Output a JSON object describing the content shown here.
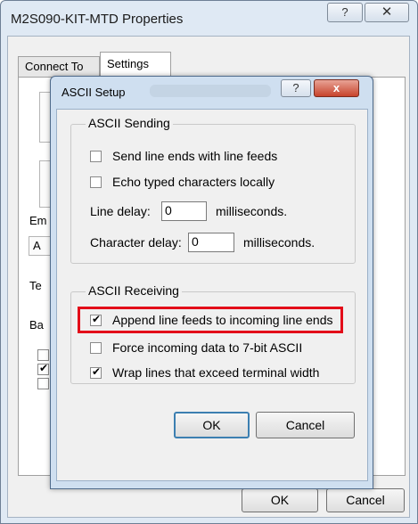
{
  "outer": {
    "title": "M2S090-KIT-MTD Properties",
    "help_glyph": "?",
    "close_glyph": "✕",
    "tabs": [
      "Connect To",
      "Settings"
    ],
    "ok_label": "OK",
    "cancel_label": "Cancel",
    "partial_labels": [
      "Em",
      "A",
      "Te",
      "Ba"
    ]
  },
  "dialog": {
    "title": "ASCII Setup",
    "help_glyph": "?",
    "close_glyph": "x",
    "sending": {
      "legend": "ASCII Sending",
      "options": [
        {
          "label": "Send line ends with line feeds",
          "checked": false
        },
        {
          "label": "Echo typed characters locally",
          "checked": false
        }
      ],
      "line_delay_label": "Line delay:",
      "line_delay_value": "0",
      "line_delay_unit": "milliseconds.",
      "char_delay_label": "Character delay:",
      "char_delay_value": "0",
      "char_delay_unit": "milliseconds."
    },
    "receiving": {
      "legend": "ASCII Receiving",
      "options": [
        {
          "label": "Append line feeds to incoming line ends",
          "checked": true
        },
        {
          "label": "Force incoming data to 7-bit ASCII",
          "checked": false
        },
        {
          "label": "Wrap lines that exceed terminal width",
          "checked": true
        }
      ]
    },
    "ok_label": "OK",
    "cancel_label": "Cancel"
  },
  "colors": {
    "highlight": "#e30c19",
    "close_button": "#c7432b",
    "default_button_border": "#3c7fb1"
  }
}
